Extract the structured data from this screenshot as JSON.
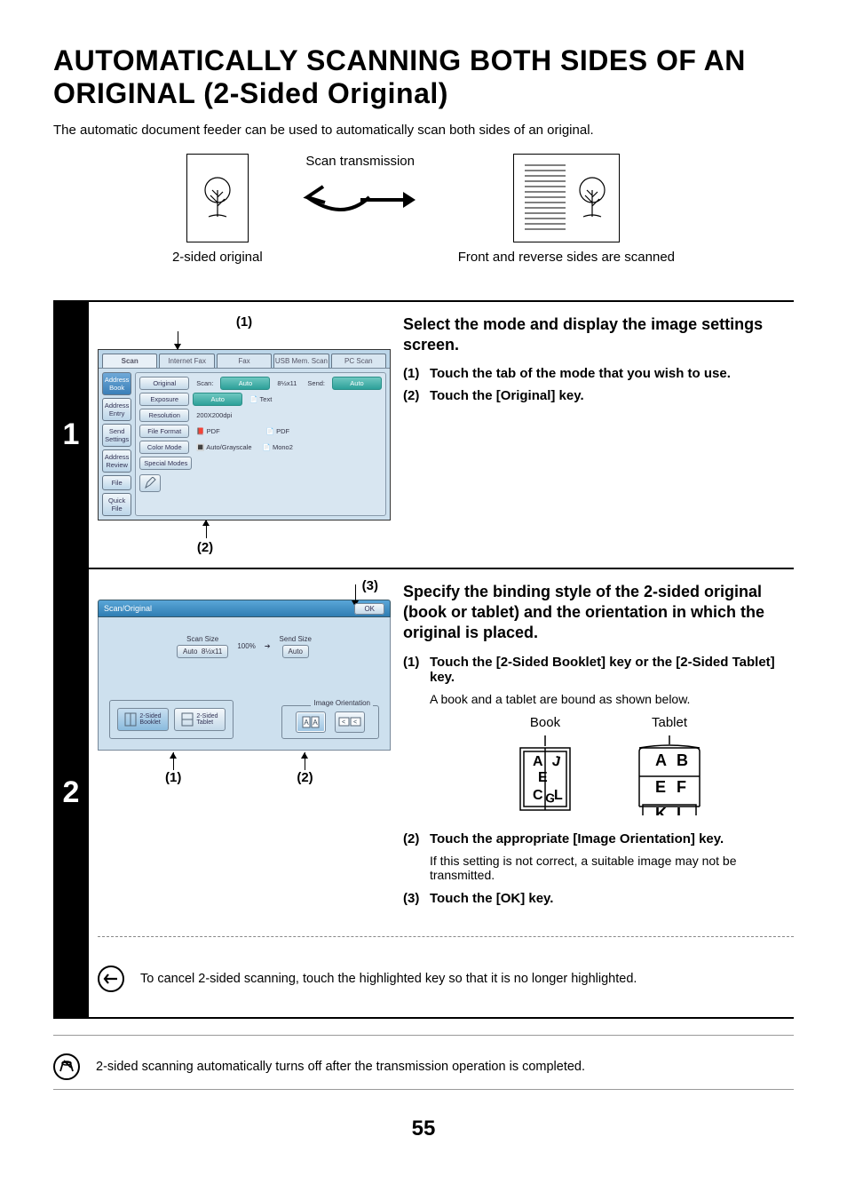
{
  "heading": "AUTOMATICALLY SCANNING BOTH SIDES OF AN ORIGINAL (2-Sided Original)",
  "intro": "The automatic document feeder can be used to automatically scan both sides of an original.",
  "diagram": {
    "left_caption": "2-sided original",
    "arrow_label": "Scan transmission",
    "right_caption": "Front and reverse sides are scanned"
  },
  "step1": {
    "number": "1",
    "callout_top": "(1)",
    "callout_bottom": "(2)",
    "panel": {
      "tabs": [
        "Scan",
        "Internet Fax",
        "Fax",
        "USB Mem. Scan",
        "PC Scan"
      ],
      "sidebar": [
        "Address Book",
        "Address Entry",
        "Send Settings",
        "Address Review",
        "File",
        "Quick File"
      ],
      "rows": {
        "original_label": "Original",
        "scan_label": "Scan:",
        "scan_val": "Auto",
        "scan_size": "8½x11",
        "send_label": "Send:",
        "send_val": "Auto",
        "exposure_label": "Exposure",
        "exposure_val": "Auto",
        "exposure_mode": "Text",
        "resolution_label": "Resolution",
        "resolution_val": "200X200dpi",
        "fileformat_label": "File Format",
        "ff_val1": "PDF",
        "ff_val2": "PDF",
        "colormode_label": "Color Mode",
        "cm_val1": "Auto/Grayscale",
        "cm_val2": "Mono2",
        "special_label": "Special Modes"
      }
    },
    "title": "Select the mode and display the image settings screen.",
    "substeps": [
      {
        "n": "(1)",
        "t": "Touch the tab of the mode that you wish to use."
      },
      {
        "n": "(2)",
        "t": "Touch the [Original] key."
      }
    ]
  },
  "step2": {
    "number": "2",
    "callout3": "(3)",
    "panel": {
      "titlebar": "Scan/Original",
      "ok": "OK",
      "scan_size_label": "Scan Size",
      "pct": "100%",
      "send_size_label": "Send Size",
      "scan_auto": "Auto",
      "scan_val": "8½x11",
      "send_auto": "Auto",
      "orientation_label": "Image Orientation",
      "booklet": "2-Sided\nBooklet",
      "tablet": "2-Sided\nTablet"
    },
    "callouts": {
      "c1": "(1)",
      "c2": "(2)"
    },
    "title": "Specify the binding style of the 2-sided original (book or tablet) and the orientation in which the original is placed.",
    "sub1": {
      "n": "(1)",
      "t": "Touch the [2-Sided Booklet] key or the [2-Sided Tablet] key.",
      "note": "A book and a tablet are bound as shown below."
    },
    "binding": {
      "book": "Book",
      "tablet": "Tablet"
    },
    "sub2": {
      "n": "(2)",
      "t": "Touch the appropriate [Image Orientation] key.",
      "note": "If this setting is not correct, a suitable image may not be transmitted."
    },
    "sub3": {
      "n": "(3)",
      "t": "Touch the [OK] key."
    },
    "cancel_note": "To cancel 2-sided scanning, touch the highlighted key so that it is no longer highlighted."
  },
  "footer_note": "2-sided scanning automatically turns off after the transmission operation is completed.",
  "page_number": "55"
}
